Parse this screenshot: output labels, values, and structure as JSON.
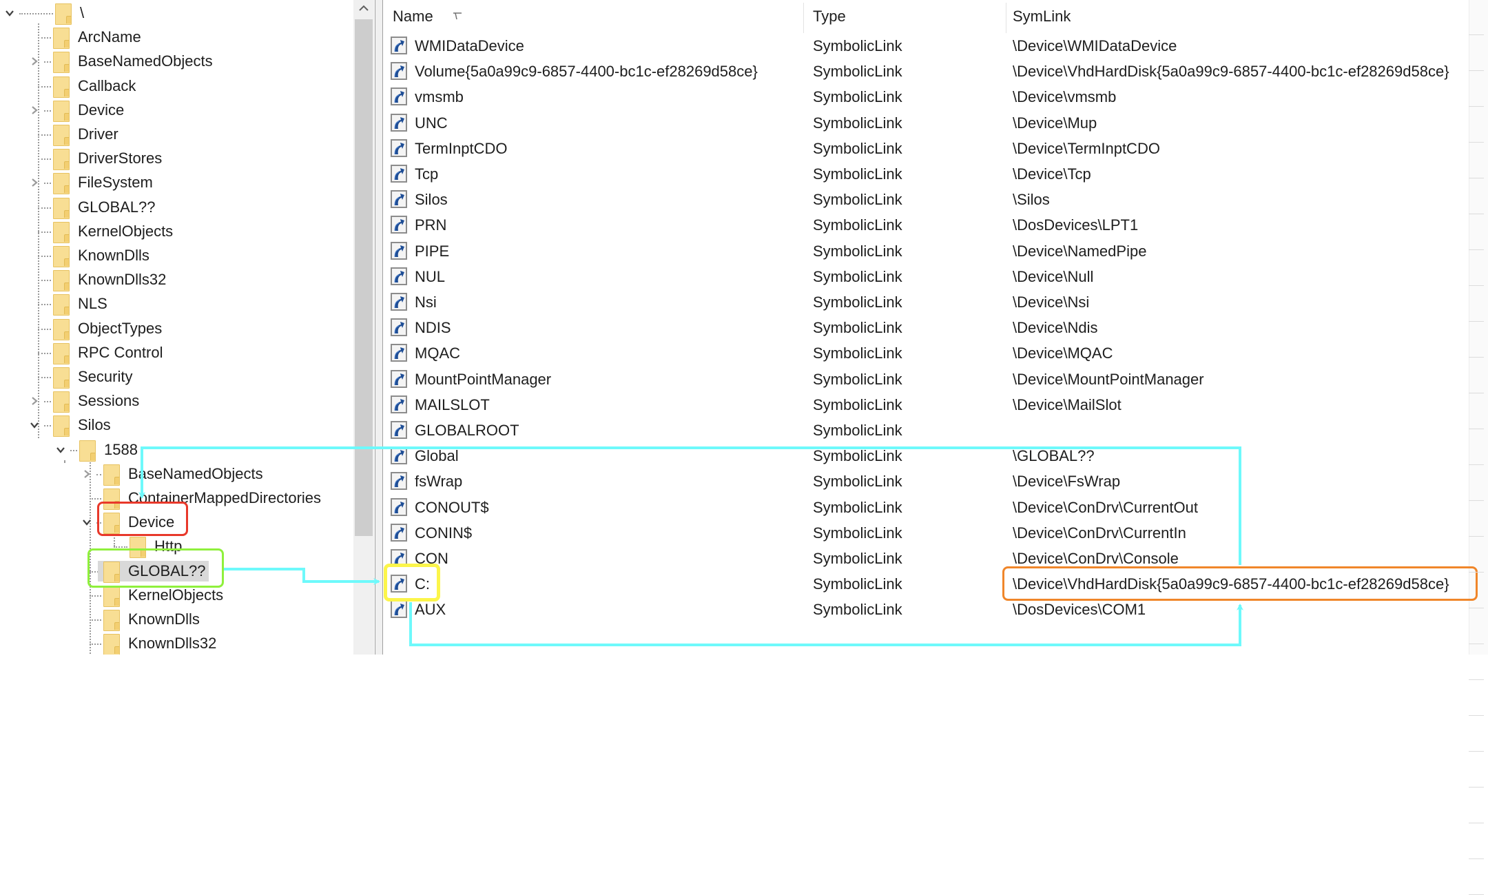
{
  "tree": {
    "nodes": [
      {
        "label": "\\",
        "level": 0,
        "expander": "expanded"
      },
      {
        "label": "ArcName",
        "level": 1,
        "expander": "none"
      },
      {
        "label": "BaseNamedObjects",
        "level": 1,
        "expander": "collapsed"
      },
      {
        "label": "Callback",
        "level": 1,
        "expander": "none"
      },
      {
        "label": "Device",
        "level": 1,
        "expander": "collapsed"
      },
      {
        "label": "Driver",
        "level": 1,
        "expander": "none"
      },
      {
        "label": "DriverStores",
        "level": 1,
        "expander": "none"
      },
      {
        "label": "FileSystem",
        "level": 1,
        "expander": "collapsed"
      },
      {
        "label": "GLOBAL??",
        "level": 1,
        "expander": "none"
      },
      {
        "label": "KernelObjects",
        "level": 1,
        "expander": "none"
      },
      {
        "label": "KnownDlls",
        "level": 1,
        "expander": "none"
      },
      {
        "label": "KnownDlls32",
        "level": 1,
        "expander": "none"
      },
      {
        "label": "NLS",
        "level": 1,
        "expander": "none"
      },
      {
        "label": "ObjectTypes",
        "level": 1,
        "expander": "none"
      },
      {
        "label": "RPC Control",
        "level": 1,
        "expander": "none"
      },
      {
        "label": "Security",
        "level": 1,
        "expander": "none"
      },
      {
        "label": "Sessions",
        "level": 1,
        "expander": "collapsed"
      },
      {
        "label": "Silos",
        "level": 1,
        "expander": "expanded"
      },
      {
        "label": "1588",
        "level": 2,
        "expander": "expanded"
      },
      {
        "label": "BaseNamedObjects",
        "level": 3,
        "expander": "collapsed"
      },
      {
        "label": "ContainerMappedDirectories",
        "level": 3,
        "expander": "none"
      },
      {
        "label": "Device",
        "level": 3,
        "expander": "expanded"
      },
      {
        "label": "Http",
        "level": 4,
        "expander": "none"
      },
      {
        "label": "GLOBAL??",
        "level": 3,
        "expander": "none",
        "selected": true
      },
      {
        "label": "KernelObjects",
        "level": 3,
        "expander": "none"
      },
      {
        "label": "KnownDlls",
        "level": 3,
        "expander": "none"
      },
      {
        "label": "KnownDlls32",
        "level": 3,
        "expander": "none"
      }
    ]
  },
  "list": {
    "columns": {
      "name": "Name",
      "type": "Type",
      "symlink": "SymLink"
    },
    "sort_column": "Name",
    "sort_indicator": "sort-descending-icon",
    "rows": [
      {
        "name": "WMIDataDevice",
        "type": "SymbolicLink",
        "symlink": "\\Device\\WMIDataDevice"
      },
      {
        "name": "Volume{5a0a99c9-6857-4400-bc1c-ef28269d58ce}",
        "type": "SymbolicLink",
        "symlink": "\\Device\\VhdHardDisk{5a0a99c9-6857-4400-bc1c-ef28269d58ce}"
      },
      {
        "name": "vmsmb",
        "type": "SymbolicLink",
        "symlink": "\\Device\\vmsmb"
      },
      {
        "name": "UNC",
        "type": "SymbolicLink",
        "symlink": "\\Device\\Mup"
      },
      {
        "name": "TermInptCDO",
        "type": "SymbolicLink",
        "symlink": "\\Device\\TermInptCDO"
      },
      {
        "name": "Tcp",
        "type": "SymbolicLink",
        "symlink": "\\Device\\Tcp"
      },
      {
        "name": "Silos",
        "type": "SymbolicLink",
        "symlink": "\\Silos"
      },
      {
        "name": "PRN",
        "type": "SymbolicLink",
        "symlink": "\\DosDevices\\LPT1"
      },
      {
        "name": "PIPE",
        "type": "SymbolicLink",
        "symlink": "\\Device\\NamedPipe"
      },
      {
        "name": "NUL",
        "type": "SymbolicLink",
        "symlink": "\\Device\\Null"
      },
      {
        "name": "Nsi",
        "type": "SymbolicLink",
        "symlink": "\\Device\\Nsi"
      },
      {
        "name": "NDIS",
        "type": "SymbolicLink",
        "symlink": "\\Device\\Ndis"
      },
      {
        "name": "MQAC",
        "type": "SymbolicLink",
        "symlink": "\\Device\\MQAC"
      },
      {
        "name": "MountPointManager",
        "type": "SymbolicLink",
        "symlink": "\\Device\\MountPointManager"
      },
      {
        "name": "MAILSLOT",
        "type": "SymbolicLink",
        "symlink": "\\Device\\MailSlot"
      },
      {
        "name": "GLOBALROOT",
        "type": "SymbolicLink",
        "symlink": ""
      },
      {
        "name": "Global",
        "type": "SymbolicLink",
        "symlink": "\\GLOBAL??"
      },
      {
        "name": "fsWrap",
        "type": "SymbolicLink",
        "symlink": "\\Device\\FsWrap"
      },
      {
        "name": "CONOUT$",
        "type": "SymbolicLink",
        "symlink": "\\Device\\ConDrv\\CurrentOut"
      },
      {
        "name": "CONIN$",
        "type": "SymbolicLink",
        "symlink": "\\Device\\ConDrv\\CurrentIn"
      },
      {
        "name": "CON",
        "type": "SymbolicLink",
        "symlink": "\\Device\\ConDrv\\Console"
      },
      {
        "name": "C:",
        "type": "SymbolicLink",
        "symlink": "\\Device\\VhdHardDisk{5a0a99c9-6857-4400-bc1c-ef28269d58ce}"
      },
      {
        "name": "AUX",
        "type": "SymbolicLink",
        "symlink": "\\DosDevices\\COM1"
      }
    ]
  },
  "annotations": {
    "colors": {
      "arrow": "#6ef9fb",
      "tree_device_box": "#e8382a",
      "tree_global_box": "#8ff03c",
      "c_drive_box": "#fcf54a",
      "symlink_target_box": "#f0862a"
    },
    "highlighted": {
      "tree_device": "Device",
      "tree_global": "GLOBAL??",
      "list_name": "C:",
      "list_symlink": "\\Device\\VhdHardDisk{5a0a99c9-6857-4400-bc1c-ef28269d58ce}"
    }
  },
  "icons": {
    "tree_item": "folder-icon",
    "list_item": "symbolic-link-shortcut-icon",
    "expanded": "chevron-down-icon",
    "collapsed": "chevron-right-icon",
    "scroll_up": "scroll-up-arrow-icon"
  }
}
